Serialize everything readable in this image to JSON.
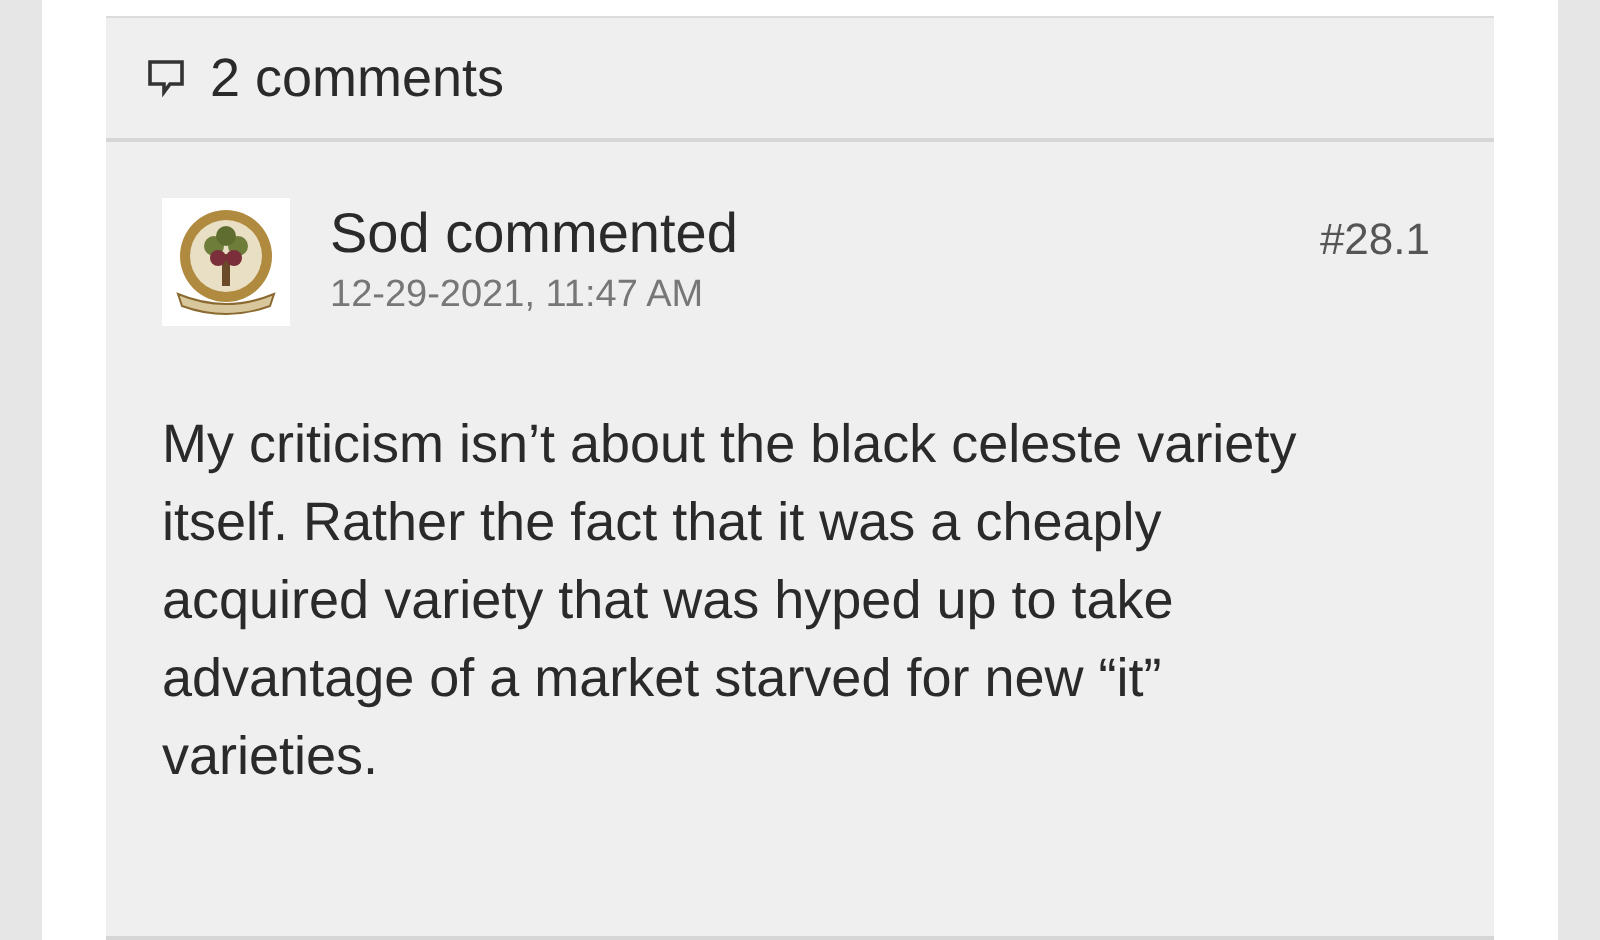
{
  "comments_header": {
    "count_label": "2 comments"
  },
  "comments": [
    {
      "author": "Sod",
      "action": "commented",
      "timestamp": "12-29-2021, 11:47 AM",
      "number": "#28.1",
      "body": "My criticism isn’t about the black celeste variety itself. Rather the fact that it was a cheaply acquired variety that was hyped up to take advantage of a market starved for new “it” varieties."
    }
  ]
}
